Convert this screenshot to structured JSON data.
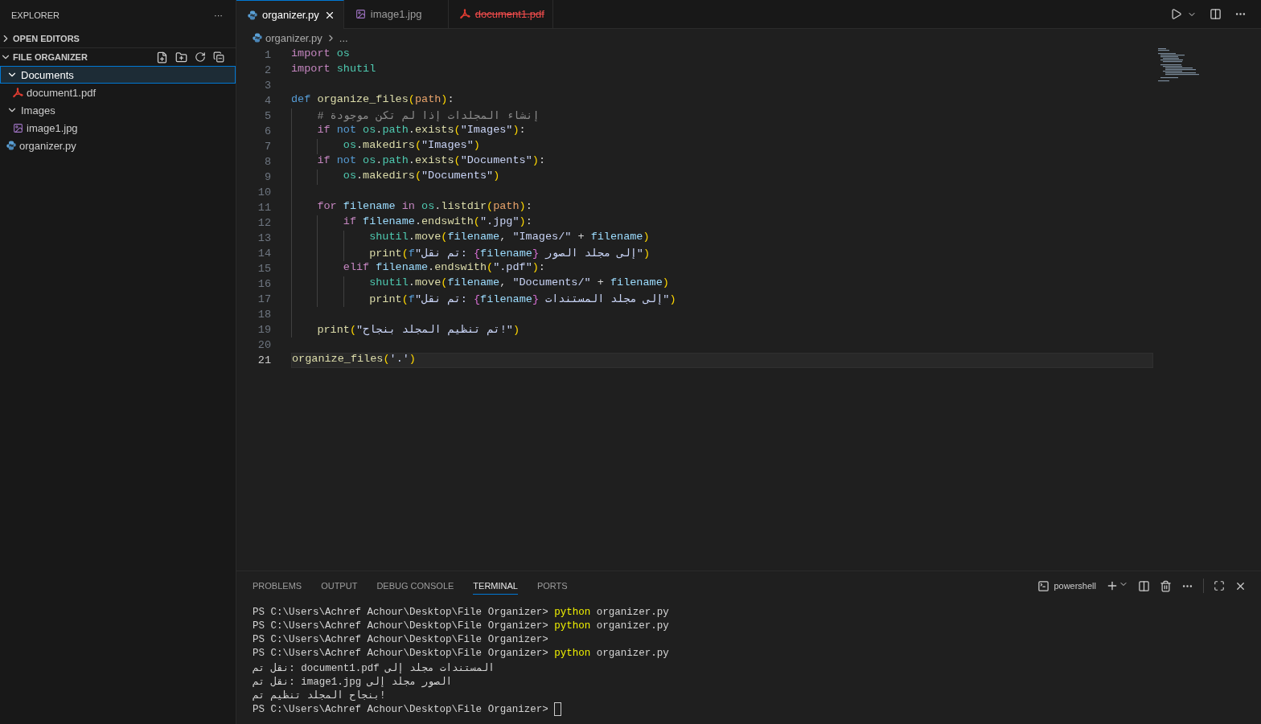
{
  "sidebar": {
    "title": "EXPLORER",
    "more": "···",
    "sections": [
      {
        "label": "OPEN EDITORS",
        "expanded": false
      },
      {
        "label": "FILE ORGANIZER",
        "expanded": true
      }
    ],
    "tree": [
      {
        "label": "Documents",
        "kind": "folder",
        "expanded": true,
        "selected": true,
        "children": [
          {
            "label": "document1.pdf",
            "kind": "pdf",
            "selected": false
          }
        ]
      },
      {
        "label": "Images",
        "kind": "folder",
        "expanded": true,
        "selected": false,
        "children": [
          {
            "label": "image1.jpg",
            "kind": "image",
            "selected": false
          }
        ]
      },
      {
        "label": "organizer.py",
        "kind": "python",
        "selected": false
      }
    ]
  },
  "tabs": [
    {
      "label": "organizer.py",
      "kind": "python",
      "selected": true,
      "deleted": false
    },
    {
      "label": "image1.jpg",
      "kind": "image",
      "selected": false,
      "deleted": false
    },
    {
      "label": "document1.pdf",
      "kind": "pdf",
      "selected": false,
      "deleted": true
    }
  ],
  "breadcrumb": {
    "file": "organizer.py",
    "rest": "..."
  },
  "code": [
    {
      "num": "1",
      "kind": "top",
      "current": false,
      "tokens": [
        {
          "t": "import ",
          "kind": "kw"
        },
        {
          "t": "os",
          "kind": "mod"
        }
      ]
    },
    {
      "num": "2",
      "kind": "top",
      "current": false,
      "tokens": [
        {
          "t": "import ",
          "kind": "kw"
        },
        {
          "t": "shutil",
          "kind": "mod"
        }
      ]
    },
    {
      "num": "3",
      "kind": "top",
      "current": false
    },
    {
      "num": "4",
      "kind": "top",
      "current": false,
      "tokens": [
        {
          "t": "def ",
          "kind": "decl"
        },
        {
          "t": "organize_files",
          "kind": "fn"
        },
        {
          "t": "(",
          "kind": "p1"
        },
        {
          "t": "path",
          "kind": "param"
        },
        {
          "t": ")",
          "kind": "p1"
        },
        {
          "t": ":",
          "kind": "plain"
        }
      ]
    },
    {
      "num": "5",
      "kind": "block",
      "current": false,
      "tokens": [
        {
          "t": "# إنشاء المجلدات إذا لم تكن موجودة",
          "kind": "cmt"
        }
      ]
    },
    {
      "num": "6",
      "kind": "block",
      "current": false,
      "tokens": [
        {
          "t": "if ",
          "kind": "kw"
        },
        {
          "t": "not ",
          "kind": "decl"
        },
        {
          "t": "os",
          "kind": "mod"
        },
        {
          "t": ".",
          "kind": "plain"
        },
        {
          "t": "path",
          "kind": "mod"
        },
        {
          "t": ".",
          "kind": "plain"
        },
        {
          "t": "exists",
          "kind": "fn"
        },
        {
          "t": "(",
          "kind": "p1"
        },
        {
          "t": "\"Images\"",
          "kind": "str"
        },
        {
          "t": ")",
          "kind": "p1"
        },
        {
          "t": ":",
          "kind": "plain"
        }
      ]
    },
    {
      "num": "7",
      "kind": "nested",
      "current": false,
      "tokens": [
        {
          "t": "os",
          "kind": "mod"
        },
        {
          "t": ".",
          "kind": "plain"
        },
        {
          "t": "makedirs",
          "kind": "fn"
        },
        {
          "t": "(",
          "kind": "p1"
        },
        {
          "t": "\"Images\"",
          "kind": "str"
        },
        {
          "t": ")",
          "kind": "p1"
        }
      ]
    },
    {
      "num": "8",
      "kind": "block",
      "current": false,
      "tokens": [
        {
          "t": "if ",
          "kind": "kw"
        },
        {
          "t": "not ",
          "kind": "decl"
        },
        {
          "t": "os",
          "kind": "mod"
        },
        {
          "t": ".",
          "kind": "plain"
        },
        {
          "t": "path",
          "kind": "mod"
        },
        {
          "t": ".",
          "kind": "plain"
        },
        {
          "t": "exists",
          "kind": "fn"
        },
        {
          "t": "(",
          "kind": "p1"
        },
        {
          "t": "\"Documents\"",
          "kind": "str"
        },
        {
          "t": ")",
          "kind": "p1"
        },
        {
          "t": ":",
          "kind": "plain"
        }
      ]
    },
    {
      "num": "9",
      "kind": "nested",
      "current": false,
      "tokens": [
        {
          "t": "os",
          "kind": "mod"
        },
        {
          "t": ".",
          "kind": "plain"
        },
        {
          "t": "makedirs",
          "kind": "fn"
        },
        {
          "t": "(",
          "kind": "p1"
        },
        {
          "t": "\"Documents\"",
          "kind": "str"
        },
        {
          "t": ")",
          "kind": "p1"
        }
      ]
    },
    {
      "num": "10",
      "kind": "block",
      "current": false
    },
    {
      "num": "11",
      "kind": "block",
      "current": false,
      "tokens": [
        {
          "t": "for ",
          "kind": "kw"
        },
        {
          "t": "filename ",
          "kind": "var"
        },
        {
          "t": "in ",
          "kind": "kw"
        },
        {
          "t": "os",
          "kind": "mod"
        },
        {
          "t": ".",
          "kind": "plain"
        },
        {
          "t": "listdir",
          "kind": "fn"
        },
        {
          "t": "(",
          "kind": "p1"
        },
        {
          "t": "path",
          "kind": "param"
        },
        {
          "t": ")",
          "kind": "p1"
        },
        {
          "t": ":",
          "kind": "plain"
        }
      ]
    },
    {
      "num": "12",
      "kind": "nested",
      "current": false,
      "tokens": [
        {
          "t": "if ",
          "kind": "kw"
        },
        {
          "t": "filename",
          "kind": "var"
        },
        {
          "t": ".",
          "kind": "plain"
        },
        {
          "t": "endswith",
          "kind": "fn"
        },
        {
          "t": "(",
          "kind": "p1"
        },
        {
          "t": "\".jpg\"",
          "kind": "str"
        },
        {
          "t": ")",
          "kind": "p1"
        },
        {
          "t": ":",
          "kind": "plain"
        }
      ]
    },
    {
      "num": "13",
      "kind": "inner",
      "current": false,
      "tokens": [
        {
          "t": "shutil",
          "kind": "mod"
        },
        {
          "t": ".",
          "kind": "plain"
        },
        {
          "t": "move",
          "kind": "fn"
        },
        {
          "t": "(",
          "kind": "p1"
        },
        {
          "t": "filename",
          "kind": "var"
        },
        {
          "t": ", ",
          "kind": "plain"
        },
        {
          "t": "\"Images/\"",
          "kind": "str"
        },
        {
          "t": " + ",
          "kind": "plain"
        },
        {
          "t": "filename",
          "kind": "var"
        },
        {
          "t": ")",
          "kind": "p1"
        }
      ]
    },
    {
      "num": "14",
      "kind": "inner",
      "current": false,
      "tokens": [
        {
          "t": "print",
          "kind": "fn"
        },
        {
          "t": "(",
          "kind": "p1"
        },
        {
          "t": "f",
          "kind": "decl"
        },
        {
          "t": "\"تم نقل: ",
          "kind": "str"
        },
        {
          "t": "{",
          "kind": "p2"
        },
        {
          "t": "filename",
          "kind": "var"
        },
        {
          "t": "}",
          "kind": "p2"
        },
        {
          "t": " إلى مجلد الصور\"",
          "kind": "str"
        },
        {
          "t": ")",
          "kind": "p1"
        }
      ]
    },
    {
      "num": "15",
      "kind": "nested",
      "current": false,
      "tokens": [
        {
          "t": "elif ",
          "kind": "kw"
        },
        {
          "t": "filename",
          "kind": "var"
        },
        {
          "t": ".",
          "kind": "plain"
        },
        {
          "t": "endswith",
          "kind": "fn"
        },
        {
          "t": "(",
          "kind": "p1"
        },
        {
          "t": "\".pdf\"",
          "kind": "str"
        },
        {
          "t": ")",
          "kind": "p1"
        },
        {
          "t": ":",
          "kind": "plain"
        }
      ]
    },
    {
      "num": "16",
      "kind": "inner",
      "current": false,
      "tokens": [
        {
          "t": "shutil",
          "kind": "mod"
        },
        {
          "t": ".",
          "kind": "plain"
        },
        {
          "t": "move",
          "kind": "fn"
        },
        {
          "t": "(",
          "kind": "p1"
        },
        {
          "t": "filename",
          "kind": "var"
        },
        {
          "t": ", ",
          "kind": "plain"
        },
        {
          "t": "\"Documents/\"",
          "kind": "str"
        },
        {
          "t": " + ",
          "kind": "plain"
        },
        {
          "t": "filename",
          "kind": "var"
        },
        {
          "t": ")",
          "kind": "p1"
        }
      ]
    },
    {
      "num": "17",
      "kind": "inner",
      "current": false,
      "tokens": [
        {
          "t": "print",
          "kind": "fn"
        },
        {
          "t": "(",
          "kind": "p1"
        },
        {
          "t": "f",
          "kind": "decl"
        },
        {
          "t": "\"تم نقل: ",
          "kind": "str"
        },
        {
          "t": "{",
          "kind": "p2"
        },
        {
          "t": "filename",
          "kind": "var"
        },
        {
          "t": "}",
          "kind": "p2"
        },
        {
          "t": " إلى مجلد المستندات\"",
          "kind": "str"
        },
        {
          "t": ")",
          "kind": "p1"
        }
      ]
    },
    {
      "num": "18",
      "kind": "block",
      "current": false
    },
    {
      "num": "19",
      "kind": "block",
      "current": false,
      "tokens": [
        {
          "t": "print",
          "kind": "fn"
        },
        {
          "t": "(",
          "kind": "p1"
        },
        {
          "t": "\"تم تنظيم المجلد بنجاح!\"",
          "kind": "str"
        },
        {
          "t": ")",
          "kind": "p1"
        }
      ]
    },
    {
      "num": "20",
      "kind": "top",
      "current": false
    },
    {
      "num": "21",
      "kind": "top",
      "current": true,
      "tokens": [
        {
          "t": "organize_files",
          "kind": "fn"
        },
        {
          "t": "(",
          "kind": "p1"
        },
        {
          "t": "'.'",
          "kind": "str"
        },
        {
          "t": ")",
          "kind": "p1"
        }
      ]
    }
  ],
  "panel": {
    "tabs": [
      {
        "label": "PROBLEMS",
        "selected": false
      },
      {
        "label": "OUTPUT",
        "selected": false
      },
      {
        "label": "DEBUG CONSOLE",
        "selected": false
      },
      {
        "label": "TERMINAL",
        "selected": true
      },
      {
        "label": "PORTS",
        "selected": false
      }
    ],
    "shell": "powershell",
    "terminal": {
      "cursor": true,
      "lines": [
        [
          {
            "t": "PS C:\\Users\\Achref Achour\\Desktop\\File Organizer> ",
            "kind": "plain"
          },
          {
            "t": "python",
            "kind": "cmd"
          },
          {
            "t": " organizer.py",
            "kind": "plain"
          }
        ],
        [
          {
            "t": "PS C:\\Users\\Achref Achour\\Desktop\\File Organizer> ",
            "kind": "plain"
          },
          {
            "t": "python",
            "kind": "cmd"
          },
          {
            "t": " organizer.py",
            "kind": "plain"
          }
        ],
        [
          {
            "t": "PS C:\\Users\\Achref Achour\\Desktop\\File Organizer>",
            "kind": "plain"
          }
        ],
        [
          {
            "t": "PS C:\\Users\\Achref Achour\\Desktop\\File Organizer> ",
            "kind": "plain"
          },
          {
            "t": "python",
            "kind": "cmd"
          },
          {
            "t": " organizer.py",
            "kind": "plain"
          }
        ],
        [
          {
            "t": "تم نقل: document1.pdf إلى مجلد المستندات",
            "kind": "plain"
          }
        ],
        [
          {
            "t": "تم نقل: image1.jpg إلى مجلد الصور",
            "kind": "plain"
          }
        ],
        [
          {
            "t": "تم تنظيم المجلد بنجاح!",
            "kind": "plain"
          }
        ],
        [
          {
            "t": "PS C:\\Users\\Achref Achour\\Desktop\\File Organizer> ",
            "kind": "plain"
          }
        ]
      ]
    }
  }
}
